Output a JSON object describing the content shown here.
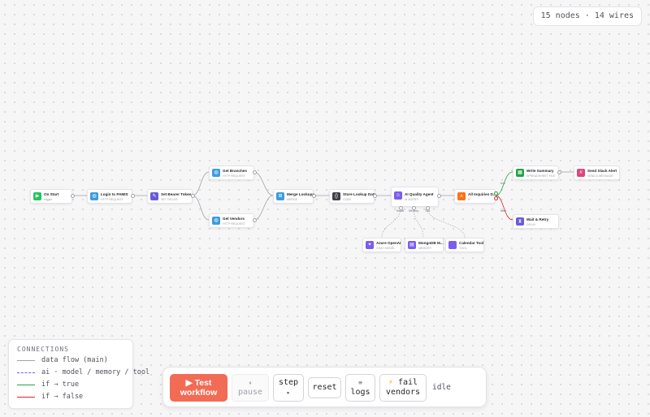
{
  "counter": "15 nodes · 14 wires",
  "nodes": {
    "on_start": {
      "title": "On Start",
      "sub": "trigger"
    },
    "login": {
      "title": "Login to PAMIS",
      "sub": "HTTP REQUEST"
    },
    "bearer": {
      "title": "Set Bearer Token",
      "sub": "SET FIELDS"
    },
    "branches": {
      "title": "Get Branches",
      "sub": "HTTP REQUEST"
    },
    "vendors": {
      "title": "Get Vendors",
      "sub": "HTTP REQUEST"
    },
    "merge": {
      "title": "Merge Lookups",
      "sub": "MERGE"
    },
    "store": {
      "title": "Store Lookup Data",
      "sub": "CODE"
    },
    "agent": {
      "title": "AI Quality Agent",
      "sub": "AI AGENT"
    },
    "openai": {
      "title": "Azure OpenAI",
      "sub": "CHAT MODEL"
    },
    "mongo": {
      "title": "MongoDB M...",
      "sub": "MEMORY"
    },
    "calendar": {
      "title": "Calendar Tool",
      "sub": "TOOL"
    },
    "inquiries": {
      "title": "All Inquiries D...",
      "sub": "IF"
    },
    "write": {
      "title": "Write Summary",
      "sub": "SPREADSHEET FILE"
    },
    "slack": {
      "title": "Send Slack Alert",
      "sub": "SEND A MESSAGE"
    },
    "wait": {
      "title": "Wait & Retry",
      "sub": "DELAY"
    }
  },
  "port_labels": {
    "model": "Model",
    "memory": "Memory",
    "tool": "Tool",
    "true": "true",
    "false": "false"
  },
  "legend": {
    "title": "CONNECTIONS",
    "items": [
      {
        "label": "data flow (main)",
        "color": "#a1a1aa",
        "style": "solid"
      },
      {
        "label": "ai · model / memory / tool",
        "color": "#6d5ce8",
        "style": "dashed"
      },
      {
        "label": "if → true",
        "color": "#22a34a",
        "style": "solid"
      },
      {
        "label": "if → false",
        "color": "#dc2626",
        "style": "solid"
      }
    ]
  },
  "toolbar": {
    "test_icon": "▶",
    "test_line1": "Test",
    "test_line2": "workflow",
    "pause_icon": "⏸",
    "pause_label": "pause",
    "step_label": "step",
    "step_icon": "▸",
    "reset_label": "reset",
    "logs_icon": "≡",
    "logs_label": "logs",
    "fail_icon": "⚡",
    "fail_line1": "fail",
    "fail_line2": "vendors",
    "status": "idle"
  },
  "colors": {
    "trigger": "#22c55e",
    "http": "#3b9ddd",
    "set": "#6a5bd6",
    "merge": "#3b9ddd",
    "code": "#3f3f46",
    "agent": "#7c5cf0",
    "if": "#f97316",
    "sheet": "#22a34a",
    "slack": "#e0457b",
    "wait": "#6a5bd6",
    "accent": "#f26b55"
  }
}
